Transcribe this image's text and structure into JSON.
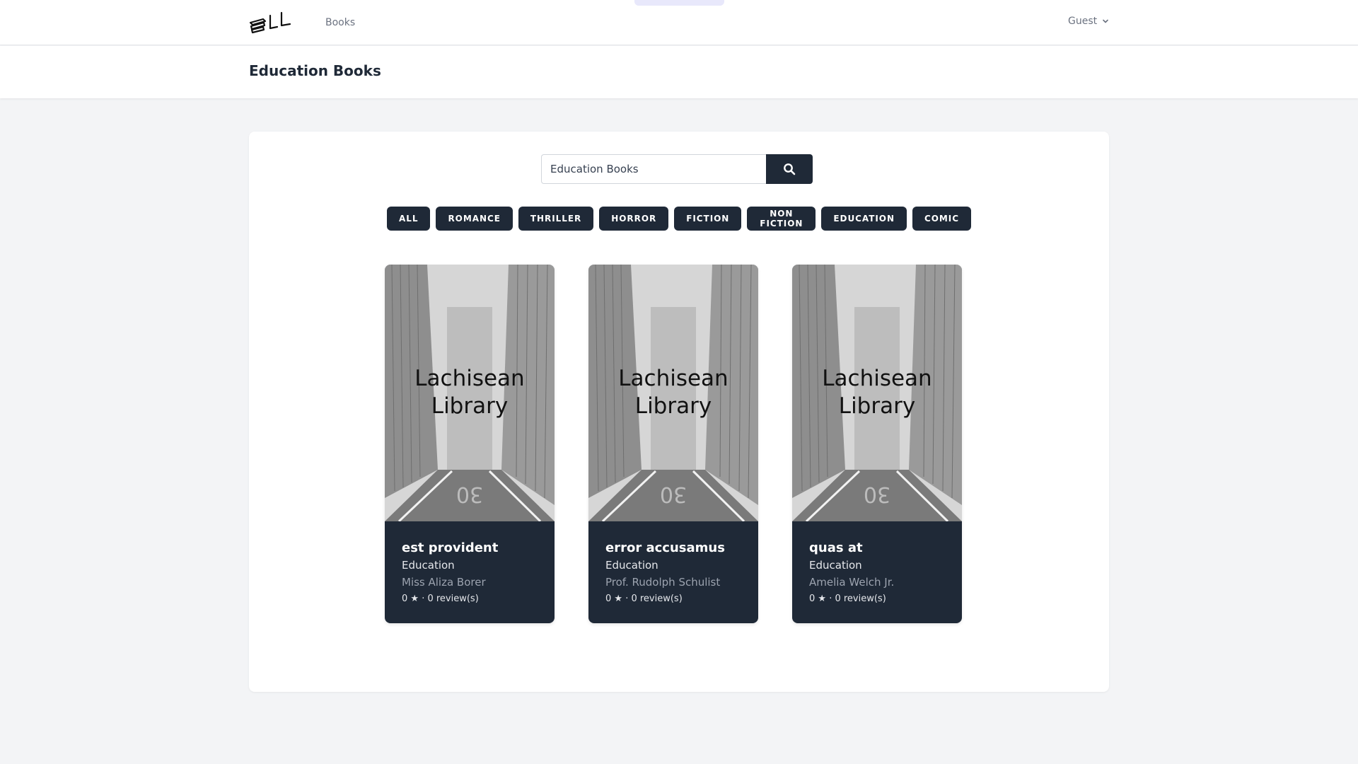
{
  "nav": {
    "books_link": "Books",
    "user_label": "Guest"
  },
  "header": {
    "title": "Education Books"
  },
  "search": {
    "value": "Education Books",
    "button_icon": "search-icon"
  },
  "filters": [
    "ALL",
    "ROMANCE",
    "THRILLER",
    "HORROR",
    "FICTION",
    "NON FICTION",
    "EDUCATION",
    "COMIC"
  ],
  "books": [
    {
      "cover_text_line1": "Lachisean",
      "cover_text_line2": "Library",
      "title": "est provident",
      "category": "Education",
      "author": "Miss Aliza Borer",
      "rating": "0 ★ · 0 review(s)"
    },
    {
      "cover_text_line1": "Lachisean",
      "cover_text_line2": "Library",
      "title": "error accusamus",
      "category": "Education",
      "author": "Prof. Rudolph Schulist",
      "rating": "0 ★ · 0 review(s)"
    },
    {
      "cover_text_line1": "Lachisean",
      "cover_text_line2": "Library",
      "title": "quas at",
      "category": "Education",
      "author": "Amelia Welch Jr.",
      "rating": "0 ★ · 0 review(s)"
    }
  ],
  "colors": {
    "primary_dark": "#1f2937",
    "page_bg": "#f3f4f6",
    "muted_text": "#6b7280"
  }
}
